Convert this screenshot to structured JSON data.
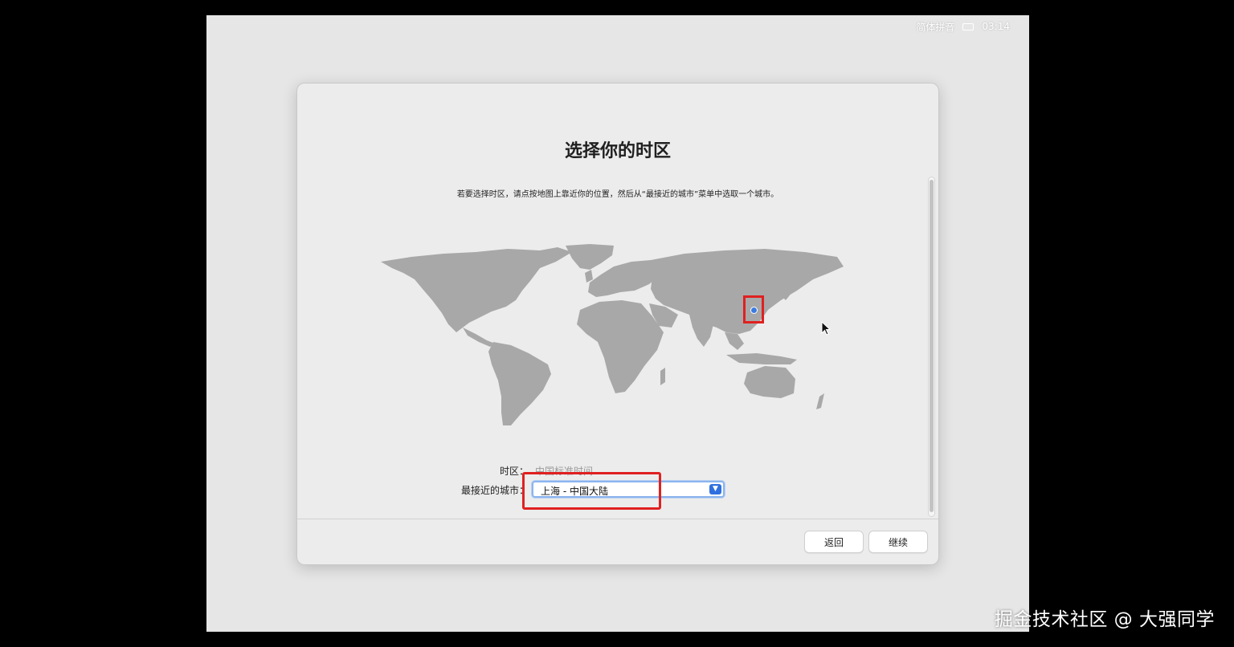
{
  "menubar": {
    "input_method": "简体拼音",
    "clock": "03:14"
  },
  "dialog": {
    "title": "选择你的时区",
    "instructions": "若要选择时区，请点按地图上靠近你的位置，然后从“最接近的城市”菜单中选取一个城市。",
    "time_zone_label": "时区：",
    "time_zone_value": "中国标准时间",
    "closest_city_label": "最接近的城市：",
    "closest_city_value": "上海 - 中国大陆",
    "back_label": "返回",
    "continue_label": "继续"
  },
  "watermark": "掘金技术社区 @ 大强同学",
  "colors": {
    "highlight": "#e02020",
    "accent": "#2f6fe0",
    "map_land": "#a8a8a8"
  }
}
